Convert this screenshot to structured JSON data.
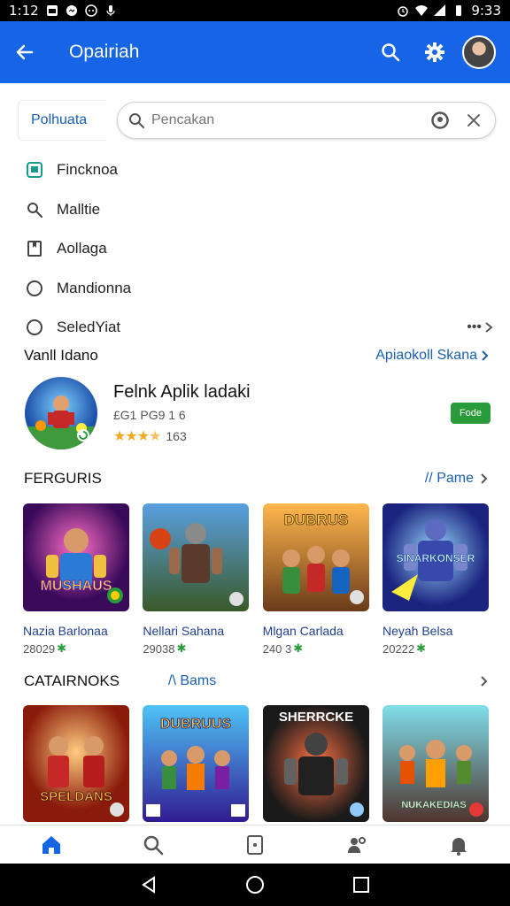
{
  "status_bar": {
    "time": "1:12",
    "right_time": "9:33"
  },
  "app_bar": {
    "title": "Opairiah"
  },
  "search": {
    "label": "Polhuata",
    "placeholder": "Pencakan"
  },
  "menu": [
    {
      "label": "Fincknoa",
      "icon": "app-square-icon"
    },
    {
      "label": "Malltie",
      "icon": "search-icon"
    },
    {
      "label": "Aollaga",
      "icon": "bookmark-icon"
    },
    {
      "label": "Mandionna",
      "icon": "circle-icon"
    },
    {
      "label": "SeledYiat",
      "icon": "circle-icon",
      "more": "•••"
    }
  ],
  "featured_section": {
    "title": "Vanll Idano",
    "link": "Apiaokoll Skana",
    "app": {
      "name": "Felnk Aplik ladaki",
      "meta": "£G1 PG9 1 6",
      "rating": 3.5,
      "rating_count": "163",
      "button": "Fode"
    }
  },
  "section_one": {
    "title": "FERGURIS",
    "link": "// Pame",
    "cards": [
      {
        "title": "Nazia Barlonaa",
        "meta": "28029",
        "art": "MUSHAUS"
      },
      {
        "title": "Nellari Sahana",
        "meta": "29038",
        "art": ""
      },
      {
        "title": "Mlgan Carlada",
        "meta": "240 3",
        "art": "DUBRUS"
      },
      {
        "title": "Neyah Belsa",
        "meta": "20222",
        "art": "SINARKONSER"
      }
    ]
  },
  "section_two": {
    "title": "CATAIRNOKS",
    "link": "/\\ Bams",
    "cards": [
      {
        "art": "SPELDANS"
      },
      {
        "art": "DUBRUUS"
      },
      {
        "art": "SHERRCKE"
      },
      {
        "art": "NUKAKEDIAS"
      }
    ]
  },
  "colors": {
    "primary": "#1565e6",
    "link": "#1b5fb3",
    "install": "#2a9b3a",
    "star": "#f2a81d"
  }
}
